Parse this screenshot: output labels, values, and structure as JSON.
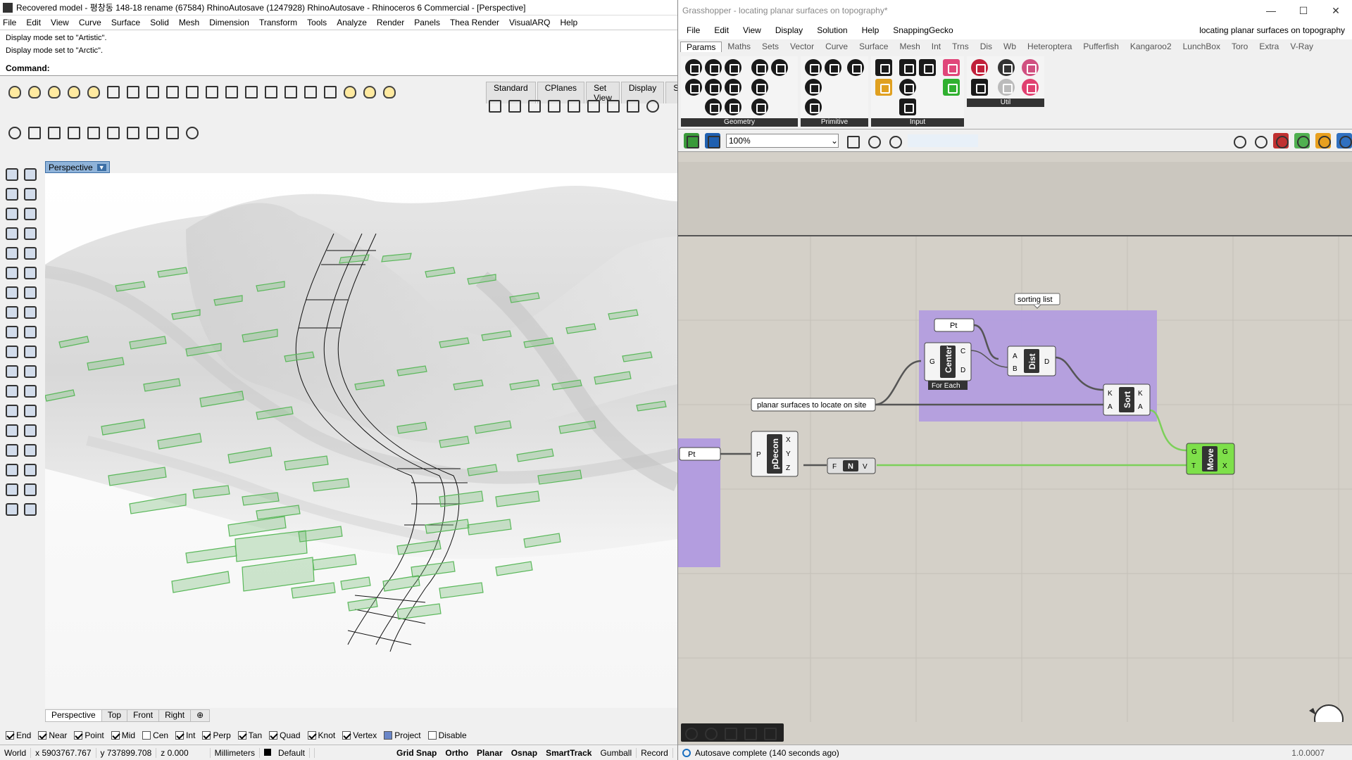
{
  "rhino": {
    "title": "Recovered model - 평창동 148-18 rename (67584) RhinoAutosave (1247928) RhinoAutosave - Rhinoceros 6 Commercial - [Perspective]",
    "menu": [
      "File",
      "Edit",
      "View",
      "Curve",
      "Surface",
      "Solid",
      "Mesh",
      "Dimension",
      "Transform",
      "Tools",
      "Analyze",
      "Render",
      "Panels",
      "Thea Render",
      "VisualARQ",
      "Help"
    ],
    "history": [
      "Display mode set to \"Artistic\".",
      "Display mode set to \"Arctic\"."
    ],
    "command_label": "Command:",
    "toolbar_tabs": [
      "Standard",
      "CPlanes",
      "Set View",
      "Display",
      "S"
    ],
    "viewport_label": "Perspective",
    "viewport_tabs": [
      "Perspective",
      "Top",
      "Front",
      "Right"
    ],
    "osnaps": [
      {
        "label": "End",
        "on": true
      },
      {
        "label": "Near",
        "on": true
      },
      {
        "label": "Point",
        "on": true
      },
      {
        "label": "Mid",
        "on": true
      },
      {
        "label": "Cen",
        "on": false
      },
      {
        "label": "Int",
        "on": true
      },
      {
        "label": "Perp",
        "on": true
      },
      {
        "label": "Tan",
        "on": true
      },
      {
        "label": "Quad",
        "on": true
      },
      {
        "label": "Knot",
        "on": true
      },
      {
        "label": "Vertex",
        "on": true
      },
      {
        "label": "Project",
        "on": true
      },
      {
        "label": "Disable",
        "on": false
      }
    ],
    "status": {
      "cplane": "World",
      "x": "x 5903767.767",
      "y": "y 737899.708",
      "z": "z 0.000",
      "units": "Millimeters",
      "layer": "Default",
      "toggles": [
        "Grid Snap",
        "Ortho",
        "Planar",
        "Osnap",
        "SmartTrack",
        "Gumball",
        "Record"
      ]
    }
  },
  "gh": {
    "title": "Grasshopper - locating planar surfaces on topography*",
    "window_controls": [
      "—",
      "☐",
      "✕"
    ],
    "menu": [
      "File",
      "Edit",
      "View",
      "Display",
      "Solution",
      "Help",
      "SnappingGecko"
    ],
    "doc_name": "locating planar surfaces on topography",
    "tabs": [
      "Params",
      "Maths",
      "Sets",
      "Vector",
      "Curve",
      "Surface",
      "Mesh",
      "Int",
      "Trns",
      "Dis",
      "Wb",
      "Heteroptera",
      "Pufferfish",
      "Kangaroo2",
      "LunchBox",
      "Toro",
      "Extra",
      "V-Ray"
    ],
    "groups": [
      "Geometry",
      "Primitive",
      "Input",
      "Util"
    ],
    "zoom": "100%",
    "search_placeholder": "",
    "canvas": {
      "group_label": "sorting list",
      "pt_top": "Pt",
      "pt_left": "Pt",
      "panel_text": "planar surfaces to locate on site",
      "center_name": "Center",
      "center_in": "G",
      "center_out": [
        "C",
        "D"
      ],
      "center_footer": "For Each",
      "dist_name": "Dist",
      "dist_in": [
        "A",
        "B"
      ],
      "dist_out": "D",
      "sort_name": "Sort",
      "sort_in": [
        "K",
        "A"
      ],
      "sort_out": [
        "K",
        "A"
      ],
      "pdecon_name": "pDecon",
      "pdecon_in": "P",
      "pdecon_out": [
        "X",
        "Y",
        "Z"
      ],
      "vec_name": "N",
      "vec_in": "F",
      "vec_out": "V",
      "move_name": "Move",
      "move_in": [
        "G",
        "T"
      ],
      "move_out": [
        "G",
        "X"
      ]
    },
    "status": "Autosave complete (140 seconds ago)",
    "version": "1.0.0007"
  }
}
